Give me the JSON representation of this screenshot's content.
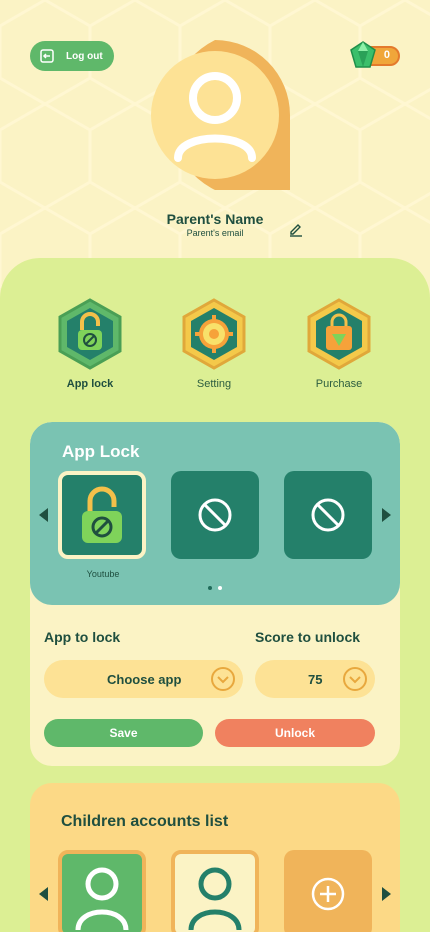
{
  "header": {
    "logout_label": "Log out",
    "gem_count": "0"
  },
  "profile": {
    "name": "Parent's Name",
    "email": "Parent's email"
  },
  "features": [
    {
      "label": "App lock",
      "icon": "padlock-hex-icon",
      "active": true
    },
    {
      "label": "Setting",
      "icon": "gear-hex-icon",
      "active": false
    },
    {
      "label": "Purchase",
      "icon": "shopping-bag-hex-icon",
      "active": false
    }
  ],
  "app_lock": {
    "title": "App Lock",
    "slots": [
      {
        "name": "Youtube",
        "icon": "locked-padlock-icon",
        "selected": true
      },
      {
        "name": "",
        "icon": "block-icon",
        "selected": false
      },
      {
        "name": "",
        "icon": "block-icon",
        "selected": false
      }
    ],
    "app_to_lock_label": "App to lock",
    "score_to_unlock_label": "Score to unlock",
    "choose_app_value": "Choose app",
    "score_value": "75",
    "save_label": "Save",
    "unlock_label": "Unlock"
  },
  "children": {
    "title": "Children accounts list"
  },
  "colors": {
    "green": "#5fb86a",
    "teal": "#7ac3b2",
    "dark_teal": "#24806a",
    "orange": "#f0815f",
    "cream": "#fbf3c5",
    "lime": "#dcef94",
    "yellow": "#fcd986"
  }
}
